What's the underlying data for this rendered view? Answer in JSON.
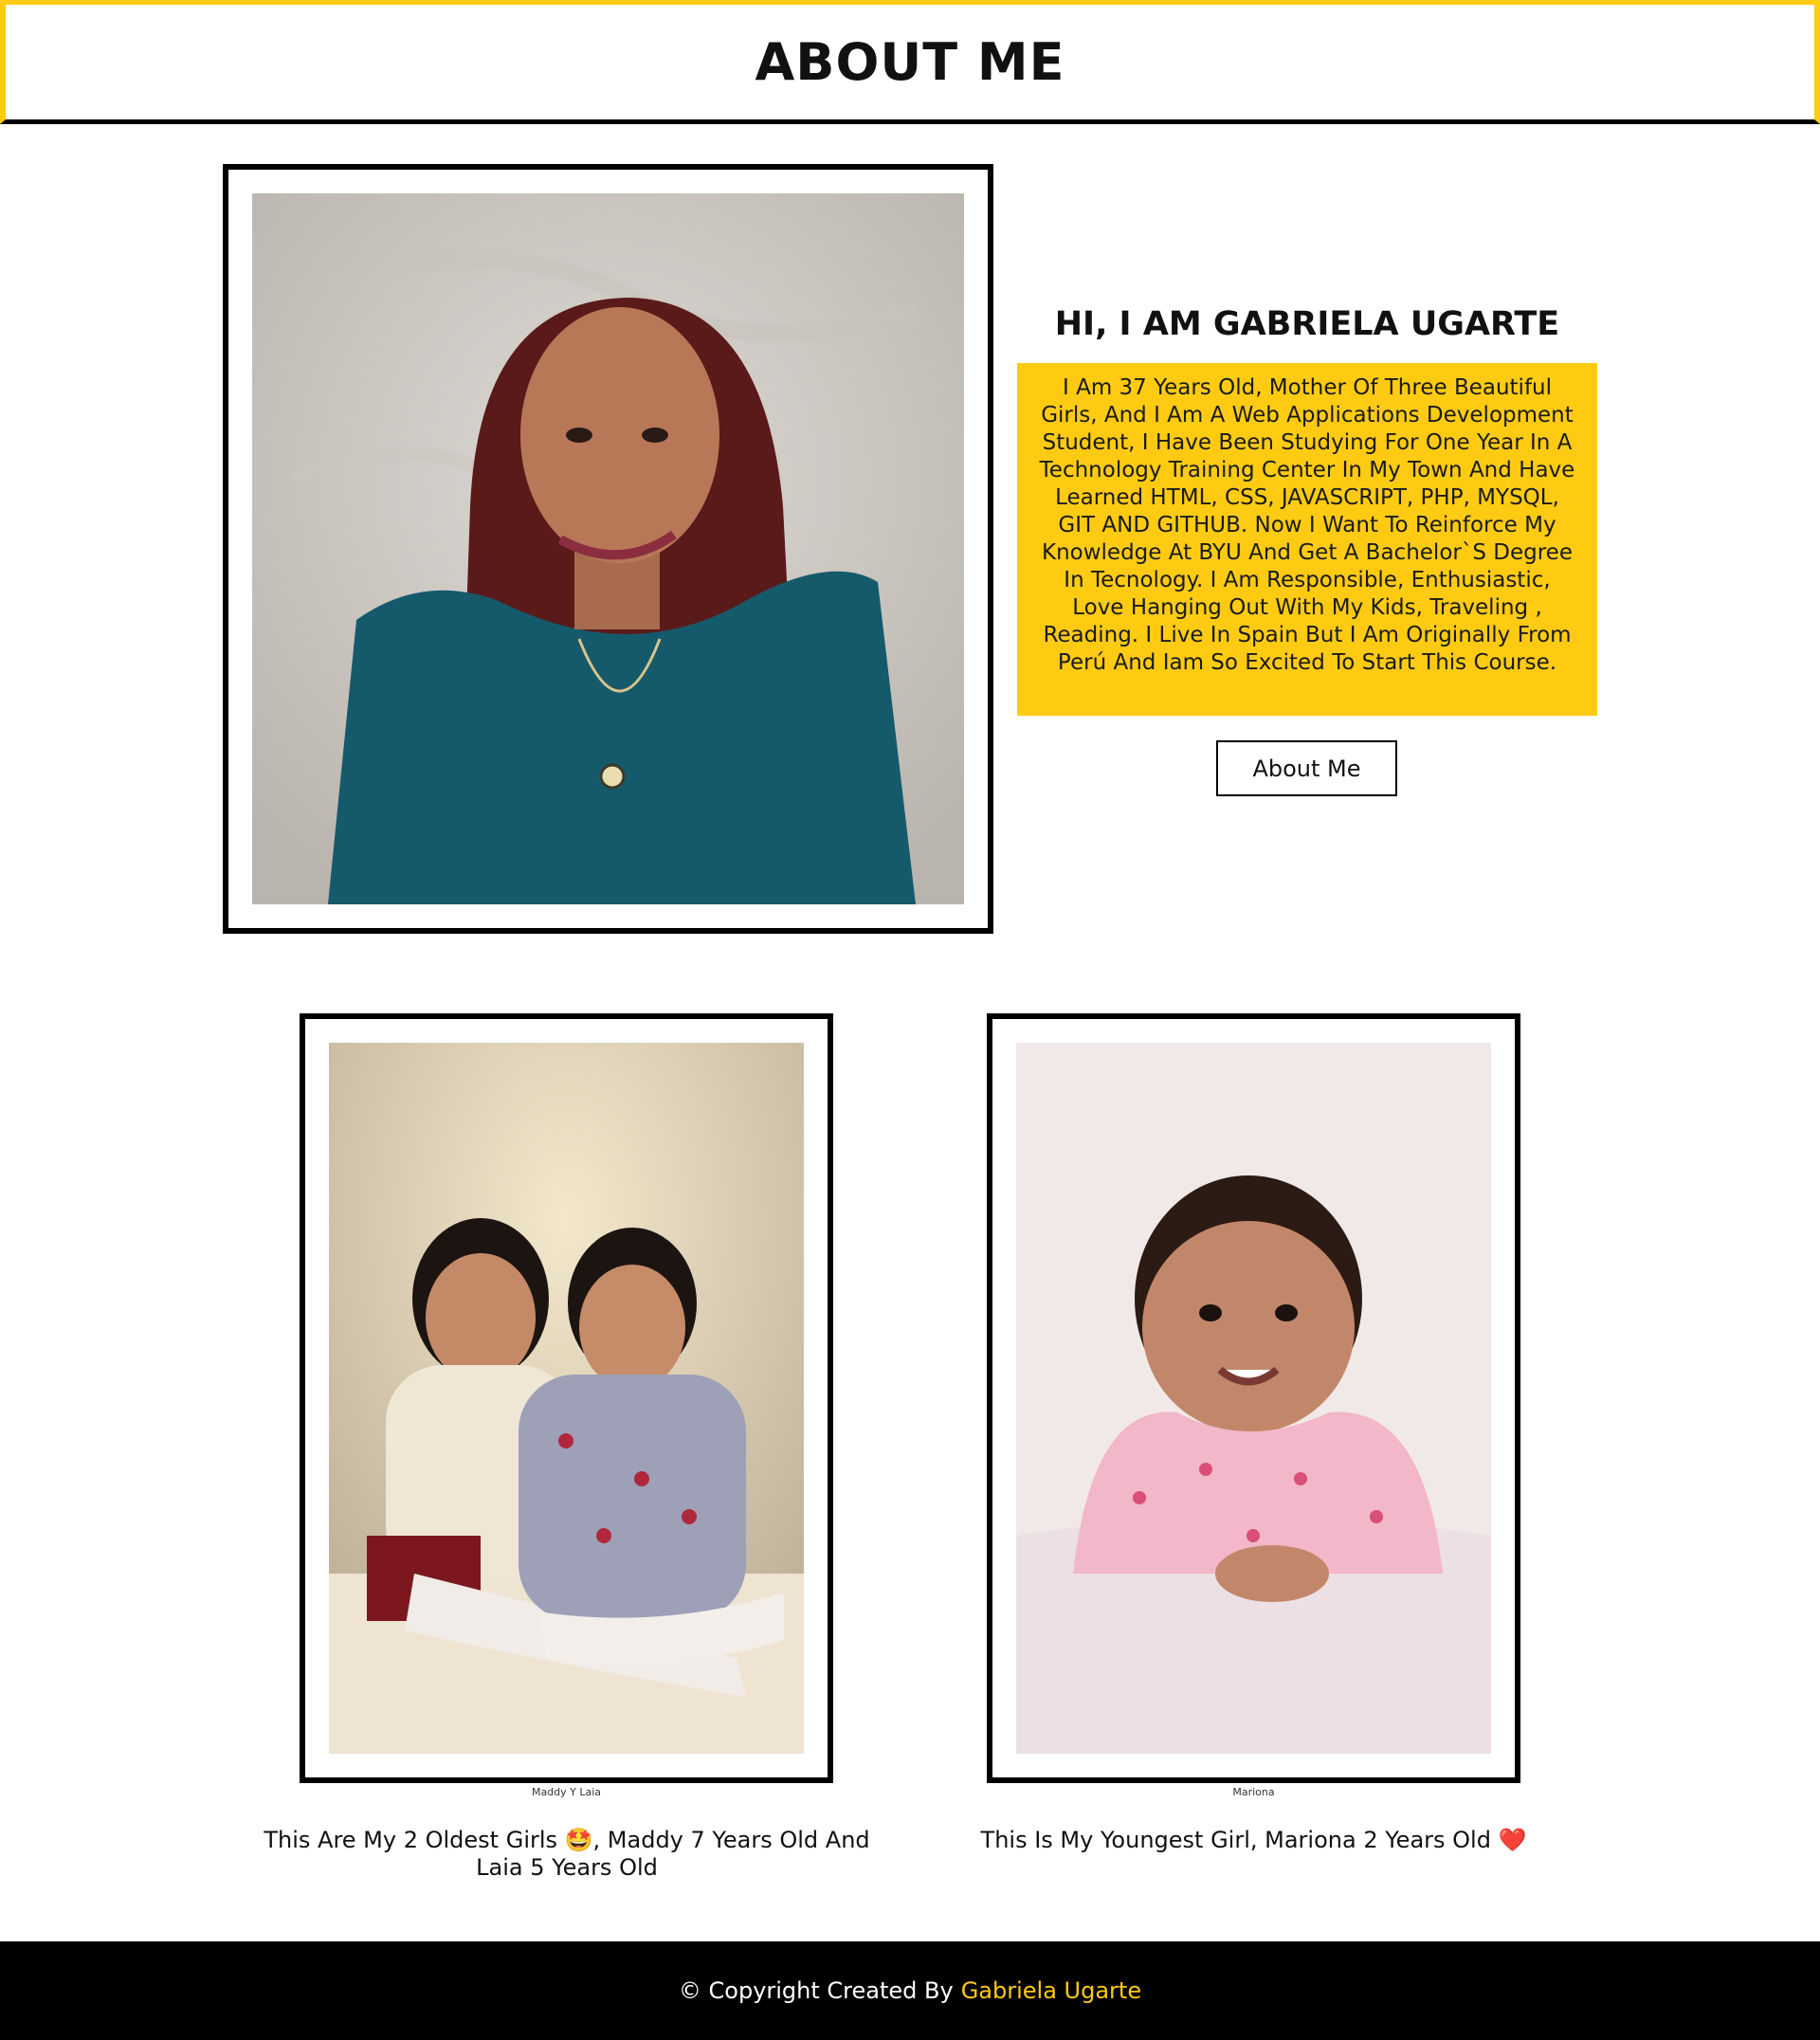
{
  "header": {
    "title": "ABOUT ME"
  },
  "intro": {
    "heading": "HI, I AM GABRIELA UGARTE",
    "bio": "I Am 37 Years Old, Mother Of Three Beautiful Girls, And I Am A Web Applications Development Student, I Have Been Studying For One Year In A Technology Training Center In My Town And Have Learned HTML, CSS, JAVASCRIPT, PHP, MYSQL, GIT AND GITHUB. Now I Want To Reinforce My Knowledge At BYU And Get A Bachelor`S Degree In Tecnology. I Am Responsible, Enthusiastic, Love Hanging Out With My Kids, Traveling , Reading. I Live In Spain But I Am Originally From Perú And Iam So Excited To Start This Course.",
    "button_label": "About Me"
  },
  "gallery": {
    "girls": {
      "caption": "Maddy Y Laia",
      "description": "This Are My 2 Oldest Girls 🤩, Maddy 7 Years Old And Laia 5 Years Old"
    },
    "baby": {
      "caption": "Mariona",
      "description": "This Is My Youngest Girl, Mariona 2 Years Old ❤️"
    }
  },
  "footer": {
    "prefix": "© Copyright Created By",
    "author": "Gabriela Ugarte"
  },
  "colors": {
    "accent": "#fecb12",
    "border": "#000000",
    "footer_bg": "#000000"
  }
}
